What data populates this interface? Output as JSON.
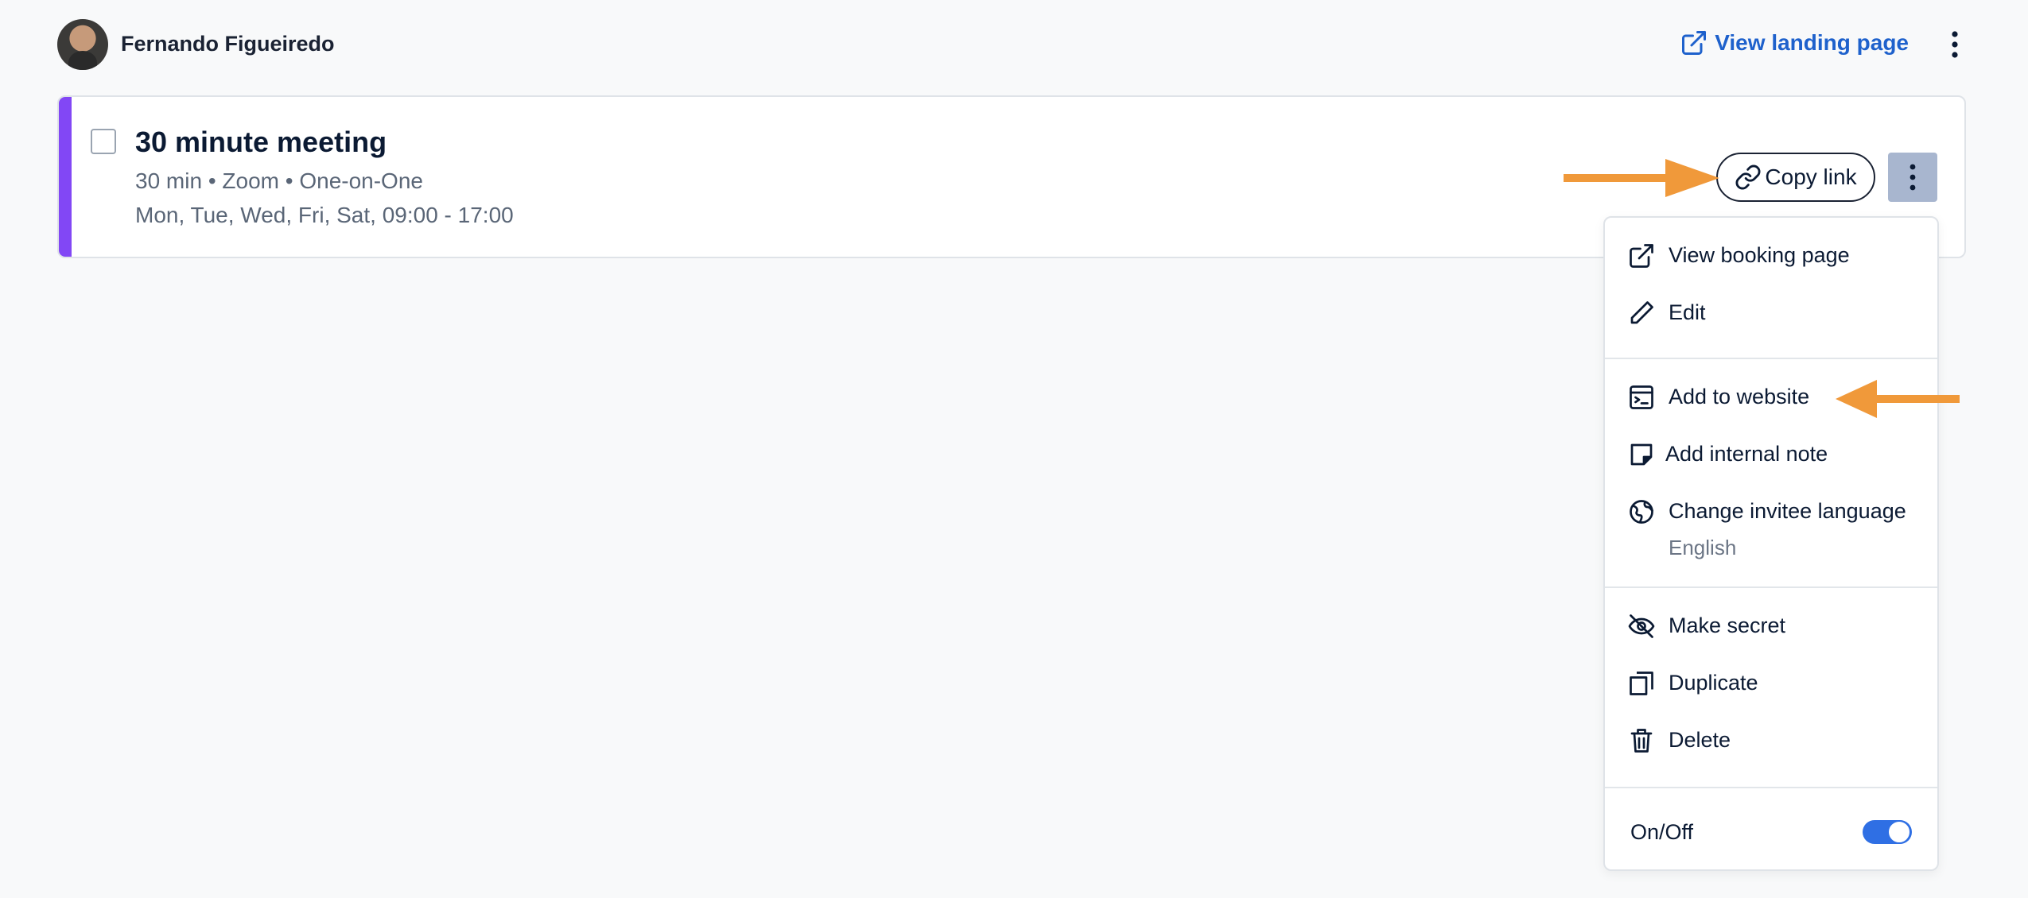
{
  "header": {
    "user_name": "Fernando Figueiredo",
    "landing_link_label": "View landing page"
  },
  "event_card": {
    "title": "30 minute meeting",
    "meta": "30 min • Zoom • One-on-One",
    "schedule": "Mon, Tue, Wed, Fri, Sat, 09:00 - 17:00",
    "copy_link_label": "Copy link",
    "stripe_color": "#8247f5"
  },
  "menu": {
    "view_booking_page": "View booking page",
    "edit": "Edit",
    "add_to_website": "Add to website",
    "add_internal_note": "Add internal note",
    "change_invitee_language": "Change invitee language",
    "invitee_language_value": "English",
    "make_secret": "Make secret",
    "duplicate": "Duplicate",
    "delete": "Delete",
    "on_off_label": "On/Off",
    "on_off_state": true
  },
  "colors": {
    "accent": "#1e61cc",
    "annotation_arrow": "#f0993a",
    "toggle_on": "#2f6fe4"
  }
}
